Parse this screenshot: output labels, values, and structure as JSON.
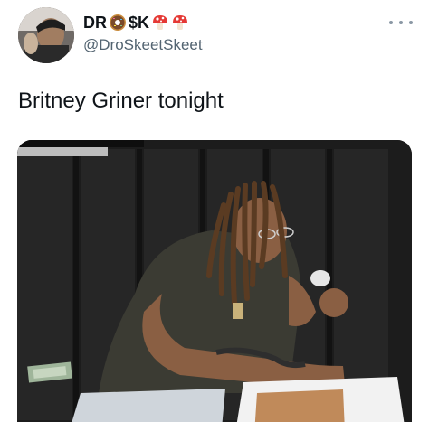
{
  "tweet": {
    "display_name": "DR",
    "display_name_suffix": "$K",
    "handle": "@DroSkeetSkeet",
    "text": "Britney Griner tonight"
  },
  "icons": {
    "more": "more-options-icon",
    "name_emoji_1": "donut-emoji-icon",
    "name_emoji_2": "mushroom-emoji-icon",
    "name_emoji_3": "mushroom-emoji-icon"
  },
  "colors": {
    "text_primary": "#0f1419",
    "text_secondary": "#536471",
    "more_dots": "#8b98a5"
  }
}
